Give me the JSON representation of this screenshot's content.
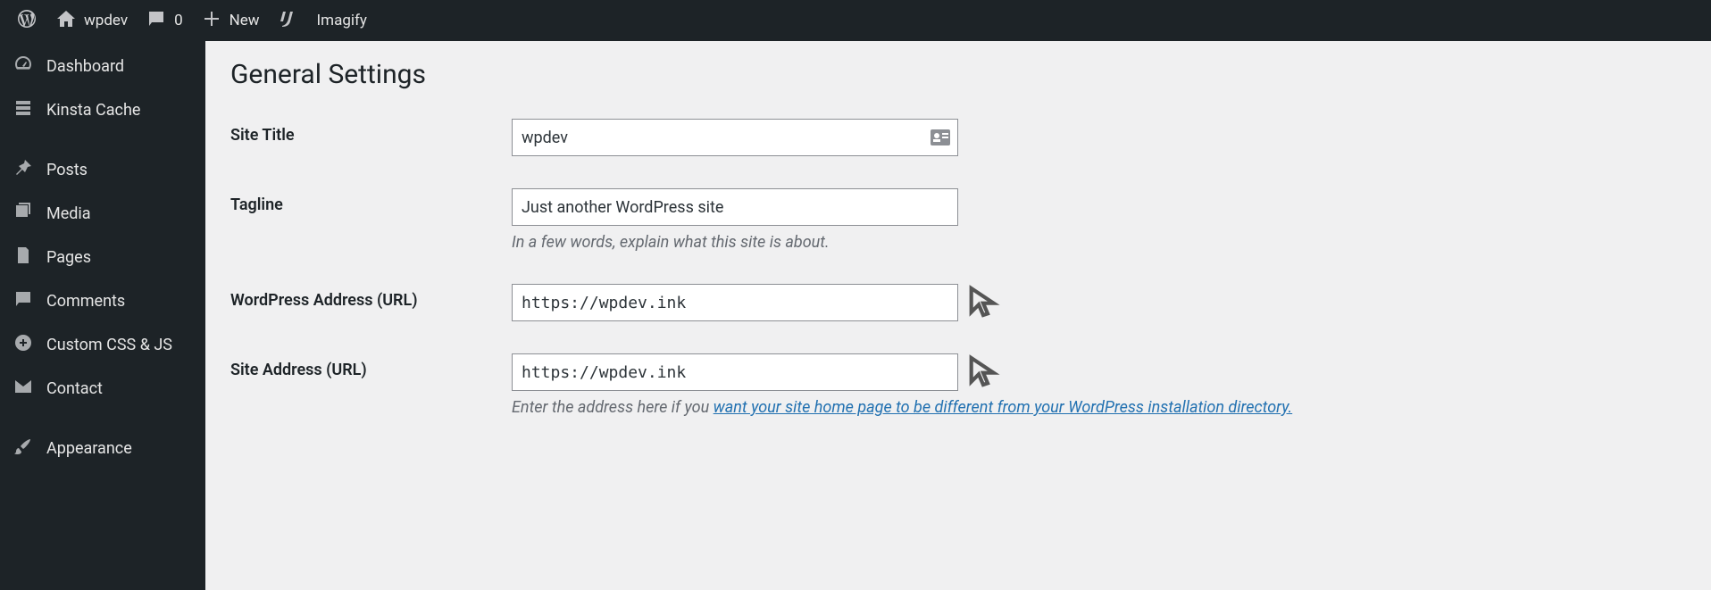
{
  "topbar": {
    "site_name": "wpdev",
    "comments_count": "0",
    "new_label": "New",
    "imagify_label": "Imagify"
  },
  "sidebar": {
    "items": [
      {
        "label": "Dashboard"
      },
      {
        "label": "Kinsta Cache"
      },
      {
        "label": "Posts"
      },
      {
        "label": "Media"
      },
      {
        "label": "Pages"
      },
      {
        "label": "Comments"
      },
      {
        "label": "Custom CSS & JS"
      },
      {
        "label": "Contact"
      },
      {
        "label": "Appearance"
      }
    ]
  },
  "page": {
    "heading": "General Settings",
    "site_title_label": "Site Title",
    "site_title_value": "wpdev",
    "tagline_label": "Tagline",
    "tagline_value": "Just another WordPress site",
    "tagline_desc": "In a few words, explain what this site is about.",
    "wp_url_label": "WordPress Address (URL)",
    "wp_url_value": "https://wpdev.ink",
    "site_url_label": "Site Address (URL)",
    "site_url_value": "https://wpdev.ink",
    "site_url_desc_prefix": "Enter the address here if you ",
    "site_url_desc_link": "want your site home page to be different from your WordPress installation directory."
  }
}
